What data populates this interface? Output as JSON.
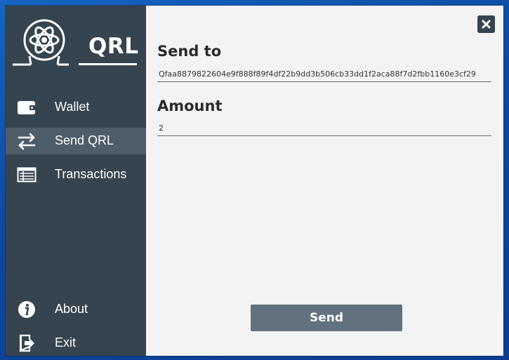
{
  "app": {
    "logo_text": "QRL"
  },
  "sidebar": {
    "items": [
      {
        "label": "Wallet",
        "icon": "wallet-icon"
      },
      {
        "label": "Send QRL",
        "icon": "transfer-arrows-icon",
        "active": true
      },
      {
        "label": "Transactions",
        "icon": "transactions-list-icon"
      },
      {
        "label": "About",
        "icon": "info-icon"
      },
      {
        "label": "Exit",
        "icon": "exit-icon"
      }
    ]
  },
  "form": {
    "send_to_label": "Send to",
    "send_to_value": "Qfaa8879822604e9f888f89f4df22b9dd3b506cb33dd1f2aca88f7d2fbb1160e3cf29",
    "amount_label": "Amount",
    "amount_value": "2",
    "send_button_label": "Send"
  },
  "colors": {
    "sidebar_bg": "#36444f",
    "sidebar_active": "#4f5d69",
    "content_bg": "#f3f3f4",
    "send_button": "#61717e",
    "desktop_bg": "#1565c0"
  }
}
